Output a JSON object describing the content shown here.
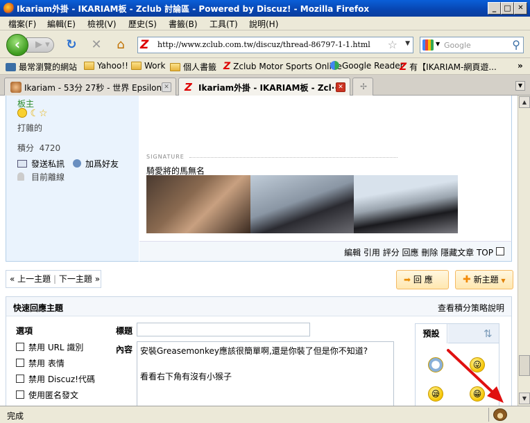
{
  "window": {
    "title": "Ikariam外掛 - IKARIAM板 - Zclub 討論區 - Powered by Discuz! - Mozilla Firefox",
    "minimize": "_",
    "maximize": "□",
    "close": "✕"
  },
  "menu": [
    "檔案(F)",
    "編輯(E)",
    "檢視(V)",
    "歷史(S)",
    "書籤(B)",
    "工具(T)",
    "說明(H)"
  ],
  "nav": {
    "url": "http://www.zclub.com.tw/discuz/thread-86797-1-1.html",
    "search_placeholder": "Google"
  },
  "bookmarks": [
    "最常瀏覽的網站",
    "Yahoo!!",
    "Work",
    "個人書籤",
    "Zclub Motor Sports Online",
    "Google Reader",
    "有【IKARIAM-網頁遊..."
  ],
  "tabs": [
    {
      "label": "Ikariam - 53分 27秒 - 世界 Epsilon"
    },
    {
      "label": "Ikariam外掛 - IKARIAM板 - Zcl···"
    }
  ],
  "profile": {
    "role": "板主",
    "title": "打雜的",
    "points_label": "積分",
    "points": "4720",
    "send_pm": "發送私訊",
    "add_friend": "加爲好友",
    "status": "目前離線"
  },
  "post": {
    "signature_label": "SIGNATURE",
    "signature_text": "騎愛將的馬無名",
    "actions": "編輯 引用 評分 回應 刪除 隱藏文章 TOP"
  },
  "thread_nav": {
    "prev": "上一主題",
    "next": "下一主題",
    "reply": "回  應",
    "new_topic": "新主題"
  },
  "quick_reply": {
    "title": "快速回應主題",
    "points_help": "查看積分策略說明",
    "options_label": "選項",
    "subject_label": "標題",
    "content_label": "內容",
    "options": [
      "禁用 URL 識別",
      "禁用 表情",
      "禁用 Discuz!代碼",
      "使用匿名發文"
    ],
    "content_line1": "安裝Greasemonkey應該很簡單啊,還是你裝了但是你不知道?",
    "content_line2": "看看右下角有沒有小猴子",
    "smiley_tab": "預設"
  },
  "status": {
    "text": "完成"
  }
}
